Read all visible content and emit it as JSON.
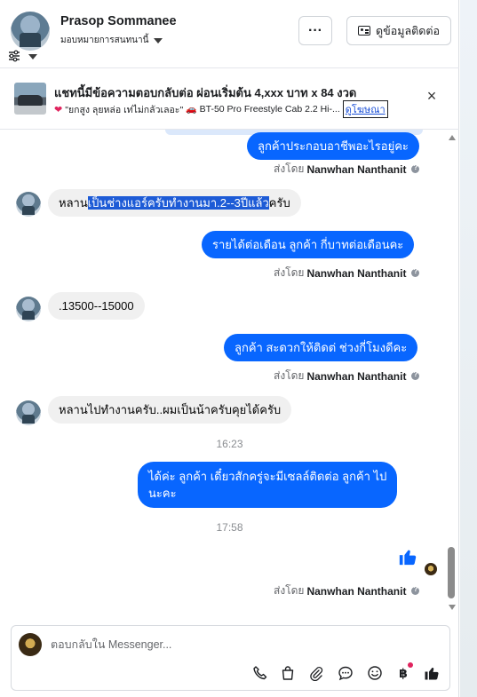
{
  "header": {
    "name": "Prasop Sommanee",
    "assign_label": "มอบหมายการสนทนานี้",
    "more_label": "···",
    "contact_button": "ดูข้อมูลติดต่อ"
  },
  "banner": {
    "title": "แชทนี้มีข้อความตอบกลับต่อ ผ่อนเริ่มต้น 4,xxx บาท x 84 งวด",
    "sub_quote": "\"ยกสูง ลุยหล่อ เท่ไม่กลัวเลอะ\"",
    "sub_model": "BT-50 Pro Freestyle Cab 2.2 Hi-...",
    "ad_link": "ดูโฆษณา",
    "close_label": "×"
  },
  "messages": [
    {
      "dir": "out",
      "text": "ลูกค้าประกอบอาชีพอะไรอยู่คะ",
      "sent_by_prefix": "ส่งโดย",
      "sent_by_name": "Nanwhan Nanthanit"
    },
    {
      "dir": "in",
      "text_pre": "หลาน",
      "text_highlight": "เป็นช่างแอร์ครับทำงานมา.2--3ปีแล้ว",
      "text_post": "ครับ"
    },
    {
      "dir": "out",
      "text": "รายได้ต่อเดือน ลูกค้า กี่บาทต่อเดือนคะ",
      "sent_by_prefix": "ส่งโดย",
      "sent_by_name": "Nanwhan Nanthanit"
    },
    {
      "dir": "in",
      "text": ".13500--15000"
    },
    {
      "dir": "out",
      "text": "ลูกค้า สะดวกให้ติดต่ ช่วงกี่โมงดีคะ",
      "sent_by_prefix": "ส่งโดย",
      "sent_by_name": "Nanwhan Nanthanit"
    },
    {
      "dir": "in",
      "text": "หลานไปทำงานครับ..ผมเป็นน้าครับคุยได้ครับ"
    },
    {
      "dir": "time",
      "text": "16:23"
    },
    {
      "dir": "out",
      "line1": "ได้ค่ะ  ลูกค้า เดี๋ยวสักครู่จะมีเซลล์ติดต่อ ลูกค้า ไป",
      "line2": "นะคะ"
    },
    {
      "dir": "time",
      "text": "17:58"
    },
    {
      "dir": "like",
      "sent_by_prefix": "ส่งโดย",
      "sent_by_name": "Nanwhan Nanthanit"
    }
  ],
  "composer": {
    "placeholder": "ตอบกลับใน Messenger..."
  },
  "icons": {
    "filter": "sliders-icon",
    "phone": "phone-icon",
    "bag": "shopping-bag-icon",
    "attach": "paperclip-icon",
    "reply": "chat-bubble-icon",
    "emoji": "smiley-icon",
    "baht": "baht-icon",
    "like": "thumbs-up-icon"
  },
  "colors": {
    "outgoing_bubble": "#0866ff",
    "incoming_bubble": "#f0f0f0",
    "highlight": "#1d5bd6"
  }
}
